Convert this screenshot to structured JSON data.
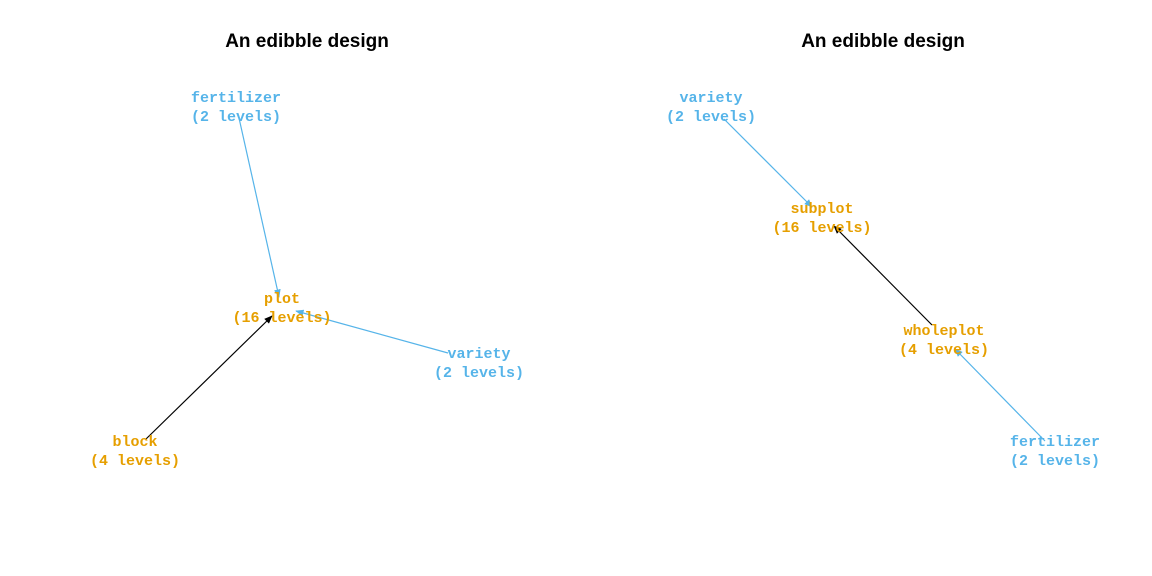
{
  "colors": {
    "unit": "#E69F00",
    "treatment": "#56B4E9",
    "unit_edge": "#000000",
    "treatment_edge": "#56B4E9"
  },
  "panels": [
    {
      "title": "An edibble design",
      "nodes": [
        {
          "id": "fertilizer",
          "label": "fertilizer",
          "sublabel": "(2 levels)",
          "role": "treatment"
        },
        {
          "id": "plot",
          "label": "plot",
          "sublabel": "(16 levels)",
          "role": "unit"
        },
        {
          "id": "variety",
          "label": "variety",
          "sublabel": "(2 levels)",
          "role": "treatment"
        },
        {
          "id": "block",
          "label": "block",
          "sublabel": "(4 levels)",
          "role": "unit"
        }
      ],
      "edges": [
        {
          "from": "fertilizer",
          "to": "plot",
          "type": "treatment"
        },
        {
          "from": "variety",
          "to": "plot",
          "type": "treatment"
        },
        {
          "from": "block",
          "to": "plot",
          "type": "unit"
        }
      ]
    },
    {
      "title": "An edibble design",
      "nodes": [
        {
          "id": "variety",
          "label": "variety",
          "sublabel": "(2 levels)",
          "role": "treatment"
        },
        {
          "id": "subplot",
          "label": "subplot",
          "sublabel": "(16 levels)",
          "role": "unit"
        },
        {
          "id": "wholeplot",
          "label": "wholeplot",
          "sublabel": "(4 levels)",
          "role": "unit"
        },
        {
          "id": "fertilizer",
          "label": "fertilizer",
          "sublabel": "(2 levels)",
          "role": "treatment"
        }
      ],
      "edges": [
        {
          "from": "variety",
          "to": "subplot",
          "type": "treatment"
        },
        {
          "from": "wholeplot",
          "to": "subplot",
          "type": "unit"
        },
        {
          "from": "fertilizer",
          "to": "wholeplot",
          "type": "treatment"
        }
      ]
    }
  ]
}
